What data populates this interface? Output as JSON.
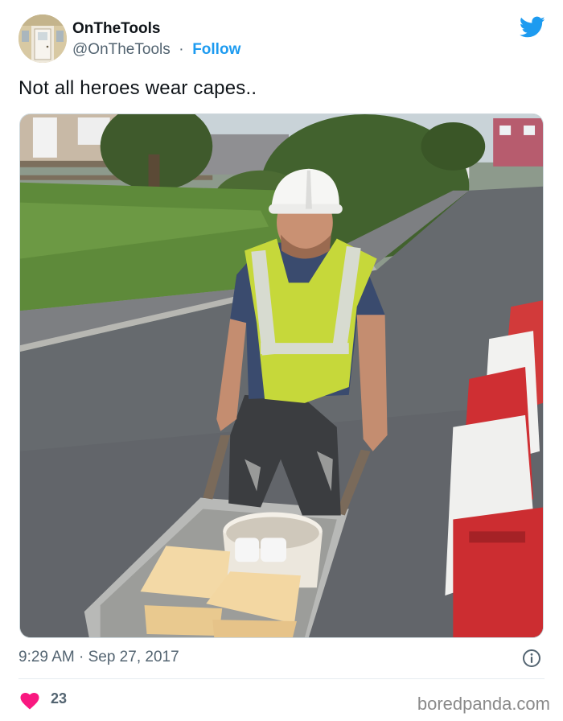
{
  "author": {
    "display_name": "OnTheTools",
    "handle": "@OnTheTools",
    "separator": "·",
    "follow_label": "Follow"
  },
  "platform_icon": "twitter-bird-icon",
  "tweet": {
    "text": "Not all heroes wear capes..",
    "timestamp": "9:29 AM · Sep 27, 2017",
    "likes": "23"
  },
  "icons": {
    "info": "info-icon",
    "like": "heart-icon"
  },
  "watermark": "boredpanda.com",
  "colors": {
    "accent": "#1d9bf0",
    "heart": "#f91880",
    "secondary_text": "#536471"
  }
}
